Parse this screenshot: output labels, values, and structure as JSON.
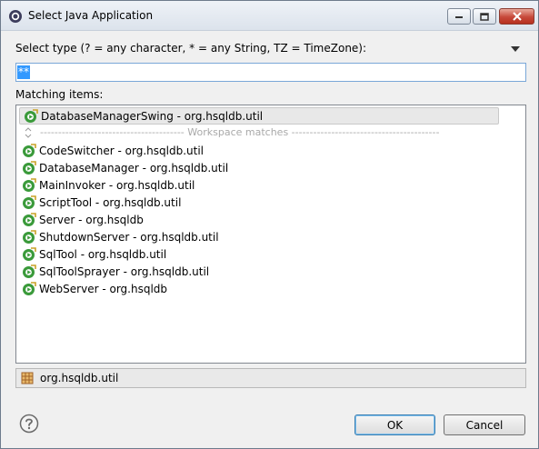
{
  "window": {
    "title": "Select Java Application"
  },
  "search": {
    "label": "Select type (? = any character, * = any String, TZ = TimeZone):",
    "value": "**"
  },
  "results": {
    "label": "Matching items:",
    "history_item": "DatabaseManagerSwing - org.hsqldb.util",
    "separator": "---------------------------------------- Workspace matches -----------------------------------------",
    "items": [
      "CodeSwitcher - org.hsqldb.util",
      "DatabaseManager - org.hsqldb.util",
      "MainInvoker - org.hsqldb.util",
      "ScriptTool - org.hsqldb.util",
      "Server - org.hsqldb",
      "ShutdownServer - org.hsqldb.util",
      "SqlTool - org.hsqldb.util",
      "SqlToolSprayer - org.hsqldb.util",
      "WebServer - org.hsqldb"
    ]
  },
  "details": {
    "package": "org.hsqldb.util"
  },
  "buttons": {
    "ok": "OK",
    "cancel": "Cancel"
  },
  "icons": {
    "app": "eclipse-icon",
    "class": "java-main-class-icon",
    "package": "package-icon",
    "help": "help-icon",
    "menu": "view-menu-icon"
  },
  "colors": {
    "selection": "#3399ff",
    "class_icon": "#3a9a3a",
    "separator_text": "#a9a9a9"
  }
}
